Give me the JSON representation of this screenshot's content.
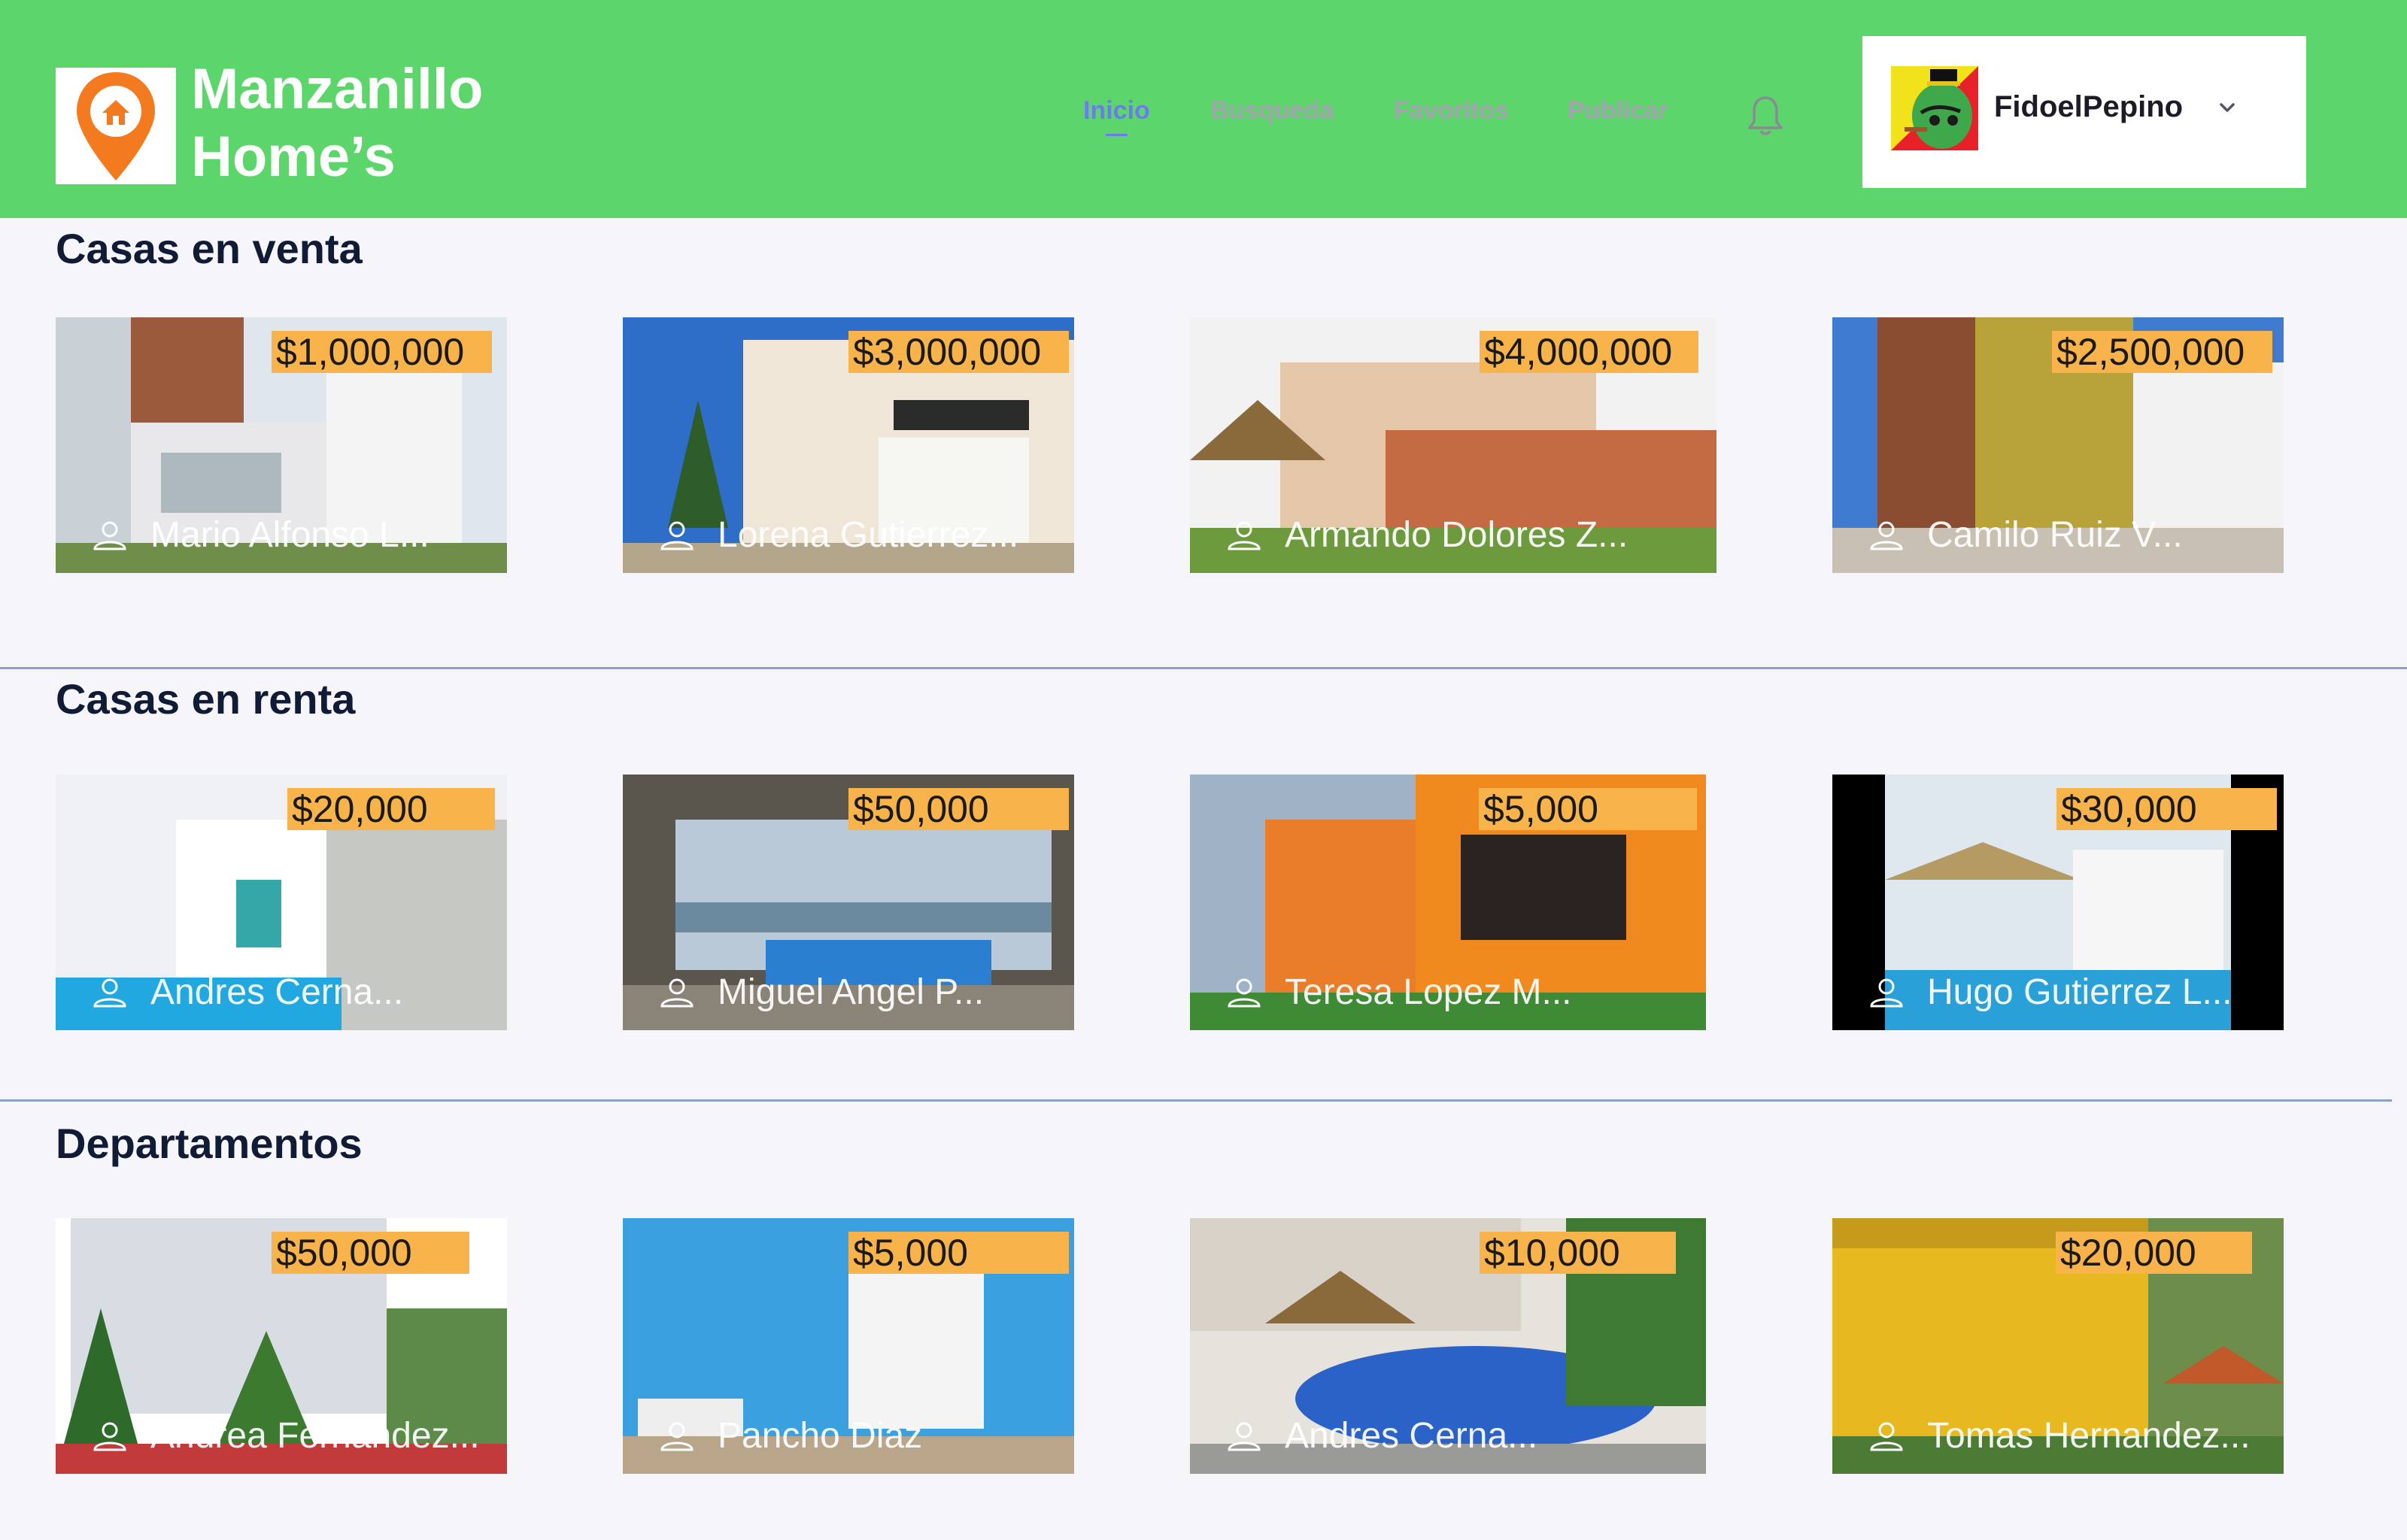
{
  "header": {
    "brand_line1": "Manzanillo",
    "brand_line2": "Home’s",
    "nav": [
      "Inicio",
      "Busqueda",
      "Favoritos",
      "Publicar"
    ],
    "active_nav": "Inicio",
    "username": "FidoelPepino",
    "colors": {
      "header_bg": "#5cd66b",
      "accent": "#6c7bf0",
      "logo_pin": "#f47a20",
      "price_tag": "#f8b34a"
    }
  },
  "sections": [
    {
      "title": "Casas en venta",
      "cards": [
        {
          "price": "$1,000,000",
          "owner": "Mario Alfonso L..."
        },
        {
          "price": "$3,000,000",
          "owner": "Lorena Gutierrez..."
        },
        {
          "price": "$4,000,000",
          "owner": "Armando Dolores Z..."
        },
        {
          "price": "$2,500,000",
          "owner": "Camilo Ruiz V..."
        }
      ]
    },
    {
      "title": "Casas en renta",
      "cards": [
        {
          "price": "$20,000",
          "owner": "Andres Cerna..."
        },
        {
          "price": "$50,000",
          "owner": "Miguel Angel P..."
        },
        {
          "price": "$5,000",
          "owner": "Teresa Lopez M..."
        },
        {
          "price": "$30,000",
          "owner": "Hugo Gutierrez L..."
        }
      ]
    },
    {
      "title": "Departamentos",
      "cards": [
        {
          "price": "$50,000",
          "owner": "Andrea Fernandez..."
        },
        {
          "price": "$5,000",
          "owner": "Pancho Diaz"
        },
        {
          "price": "$10,000",
          "owner": "Andres Cerna..."
        },
        {
          "price": "$20,000",
          "owner": "Tomas Hernandez..."
        }
      ]
    }
  ]
}
